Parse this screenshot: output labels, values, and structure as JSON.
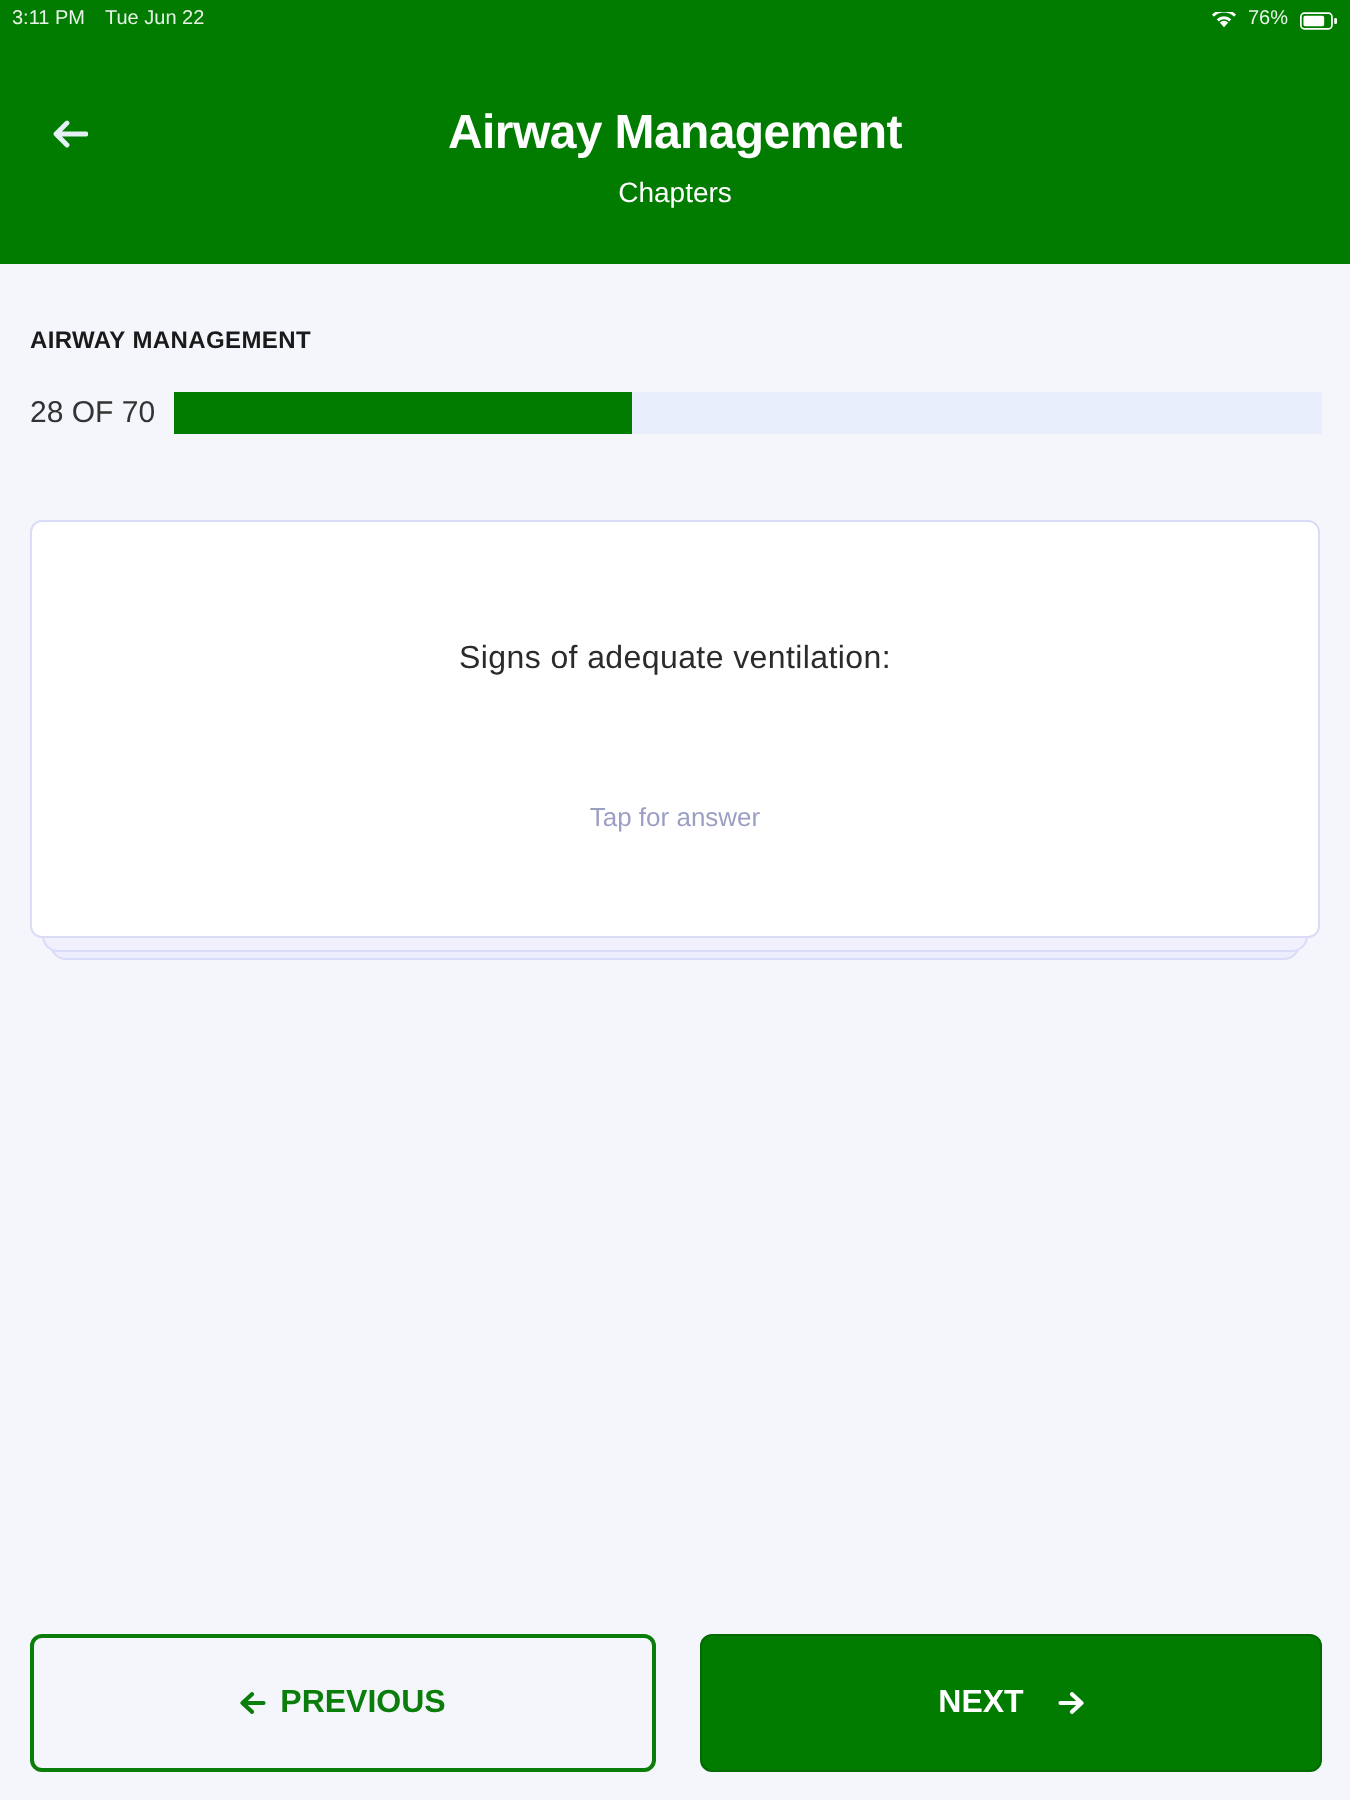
{
  "status_bar": {
    "time": "3:11 PM",
    "date": "Tue Jun 22",
    "battery": "76%"
  },
  "header": {
    "title": "Airway Management",
    "subtitle": "Chapters"
  },
  "progress": {
    "label": "AIRWAY MANAGEMENT",
    "count": "28 OF 70",
    "level": 0.4
  },
  "card": {
    "prompt": "Signs of adequate ventilation:",
    "hint": "Tap for answer"
  },
  "buttons": [
    {
      "label": "PREVIOUS",
      "kind": "back"
    },
    {
      "label": "NEXT",
      "kind": "forward"
    }
  ]
}
